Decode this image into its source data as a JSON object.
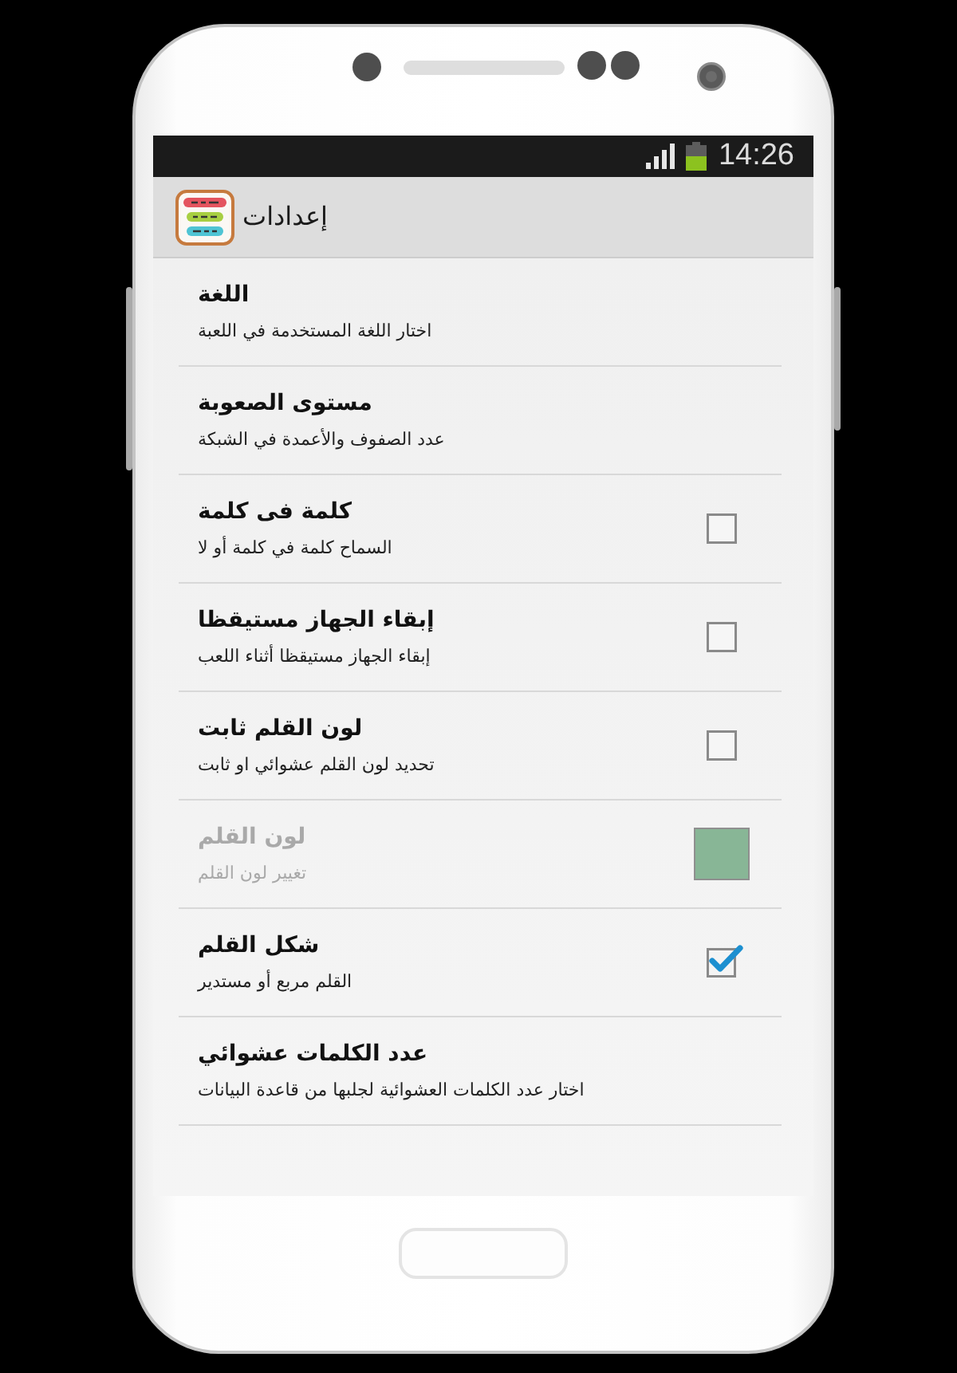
{
  "status_bar": {
    "time": "14:26"
  },
  "action_bar": {
    "title": "إعدادات"
  },
  "settings": [
    {
      "kind": "plain",
      "title": "اللغة",
      "summary": "اختار اللغة المستخدمة في اللعبة",
      "disabled": false
    },
    {
      "kind": "plain",
      "title": "مستوى الصعوبة",
      "summary": "عدد الصفوف والأعمدة في الشبكة",
      "disabled": false
    },
    {
      "kind": "checkbox",
      "title": "كلمة فى كلمة",
      "summary": "السماح كلمة في كلمة أو لا",
      "disabled": false,
      "checked": false
    },
    {
      "kind": "checkbox",
      "title": "إبقاء الجهاز مستيقظا",
      "summary": "إبقاء الجهاز مستيقظا أثناء اللعب",
      "disabled": false,
      "checked": false
    },
    {
      "kind": "checkbox",
      "title": "لون القلم ثابت",
      "summary": "تحديد لون القلم عشوائي او ثابت",
      "disabled": false,
      "checked": false
    },
    {
      "kind": "color",
      "title": "لون القلم",
      "summary": "تغيير لون القلم",
      "disabled": true,
      "color": "#88b696"
    },
    {
      "kind": "checkbox",
      "title": "شكل القلم",
      "summary": "القلم مربع أو مستدير",
      "disabled": false,
      "checked": true
    },
    {
      "kind": "plain",
      "title": "عدد الكلمات عشوائي",
      "summary": "اختار عدد الكلمات العشوائية لجلبها من قاعدة البيانات",
      "disabled": false
    }
  ]
}
